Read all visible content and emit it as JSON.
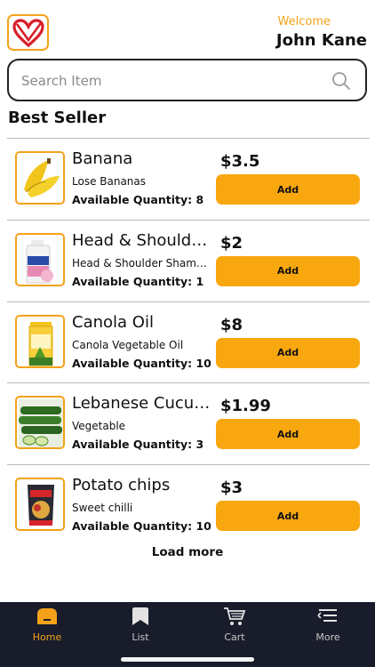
{
  "header": {
    "welcome": "Welcome",
    "username": "John Kane"
  },
  "search": {
    "placeholder": "Search Item",
    "value": ""
  },
  "section_title": "Best Seller",
  "items": [
    {
      "name": "Banana",
      "description": "Lose Bananas",
      "qty_label": "Available Quantity:",
      "qty": "8",
      "price": "$3.5",
      "add_label": "Add"
    },
    {
      "name": "Head & Shoulders",
      "description": "Head & Shoulder Shampoo",
      "qty_label": "Available Quantity:",
      "qty": "1",
      "price": "$2",
      "add_label": "Add"
    },
    {
      "name": "Canola Oil",
      "description": "Canola Vegetable Oil",
      "qty_label": "Available Quantity:",
      "qty": "10",
      "price": "$8",
      "add_label": "Add"
    },
    {
      "name": "Lebanese Cucumber",
      "description": "Vegetable",
      "qty_label": "Available Quantity:",
      "qty": "3",
      "price": "$1.99",
      "add_label": "Add"
    },
    {
      "name": "Potato chips",
      "description": "Sweet chilli",
      "qty_label": "Available Quantity:",
      "qty": "10",
      "price": "$3",
      "add_label": "Add"
    }
  ],
  "load_more": "Load more",
  "tabbar": {
    "tabs": [
      {
        "label": "Home",
        "icon": "home-icon",
        "active": true
      },
      {
        "label": "List",
        "icon": "bookmark-icon",
        "active": false
      },
      {
        "label": "Cart",
        "icon": "cart-icon",
        "active": false
      },
      {
        "label": "More",
        "icon": "menu-icon",
        "active": false
      }
    ]
  },
  "colors": {
    "accent": "#f9a70f",
    "tabbar_bg": "#191c2b",
    "active_tab": "#f3a21a"
  }
}
